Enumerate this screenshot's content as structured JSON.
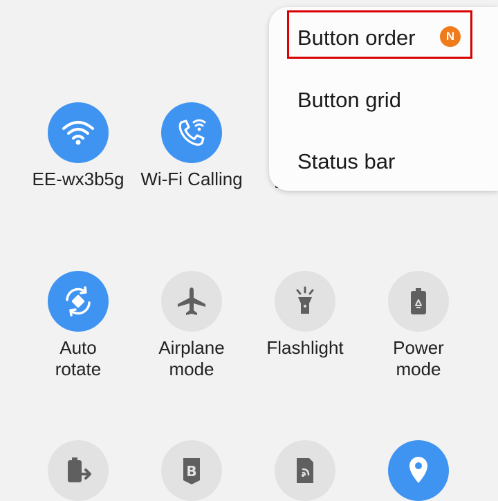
{
  "menu": {
    "items": [
      {
        "label": "Button order",
        "badge": "N"
      },
      {
        "label": "Button grid"
      },
      {
        "label": "Status bar"
      }
    ]
  },
  "tiles": [
    {
      "label": "EE-wx3b5g",
      "icon": "wifi-icon",
      "active": true
    },
    {
      "label": "Wi-Fi Calling",
      "icon": "wifi-calling-icon",
      "active": true
    },
    {
      "label": "Auto\nrotate",
      "icon": "auto-rotate-icon",
      "active": true
    },
    {
      "label": "Airplane\nmode",
      "icon": "airplane-icon",
      "active": false
    },
    {
      "label": "Flashlight",
      "icon": "flashlight-icon",
      "active": false
    },
    {
      "label": "Power\nmode",
      "icon": "power-mode-icon",
      "active": false
    },
    {
      "icon": "battery-share-icon",
      "active": false
    },
    {
      "icon": "bixby-routines-icon",
      "active": false
    },
    {
      "icon": "nfc-icon",
      "active": false
    },
    {
      "icon": "location-icon",
      "active": true
    }
  ],
  "colors": {
    "active": "#3f94f1",
    "inactive": "#e2e2e2",
    "badge": "#ef7b1a",
    "highlight": "#d90000"
  }
}
